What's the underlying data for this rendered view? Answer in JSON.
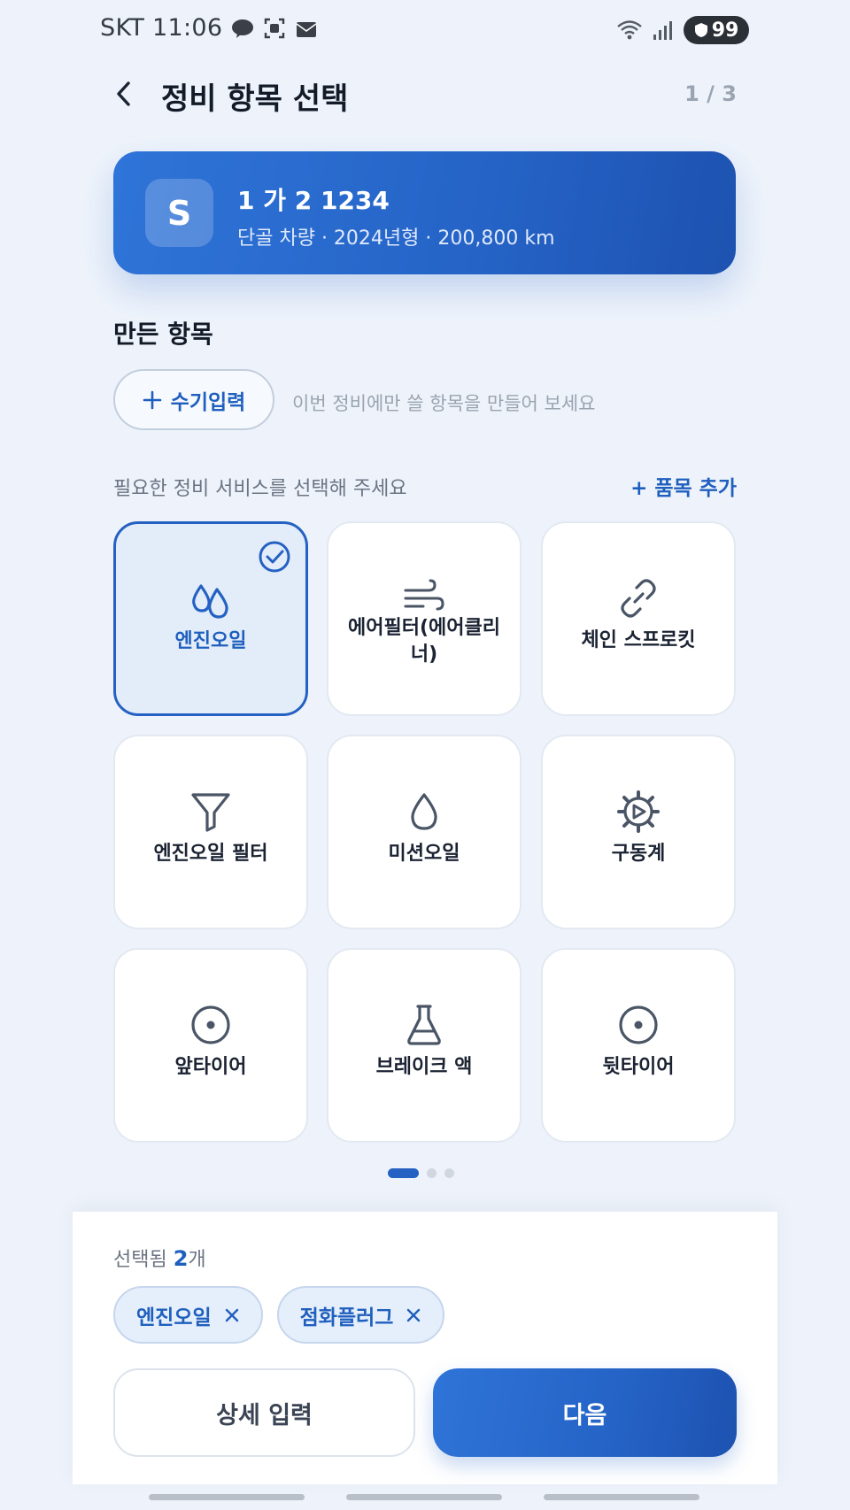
{
  "status_bar": {
    "carrier_time": "SKT 11:06",
    "battery": "99"
  },
  "header": {
    "title": "정비 항목 선택",
    "step": "1 / 3"
  },
  "vehicle": {
    "avatar_letter": "S",
    "plate": "1 가 2 1234",
    "meta": "단골 차량 · 2024년형 · 200,800 km"
  },
  "custom_section": {
    "title": "만든 항목",
    "manual_button": "수기입력",
    "hint": "이번 정비에만 쓸 항목을 만들어 보세요"
  },
  "services": {
    "prompt": "필요한 정비 서비스를 선택해 주세요",
    "add_item": "+ 품목 추가",
    "items": [
      {
        "label": "엔진오일",
        "icon": "oil-drops-icon",
        "selected": true
      },
      {
        "label": "에어필터(에어클리너)",
        "icon": "wind-icon",
        "selected": false
      },
      {
        "label": "체인 스프로킷",
        "icon": "chain-link-icon",
        "selected": false
      },
      {
        "label": "엔진오일 필터",
        "icon": "funnel-filter-icon",
        "selected": false
      },
      {
        "label": "미션오일",
        "icon": "droplet-icon",
        "selected": false
      },
      {
        "label": "구동계",
        "icon": "gear-icon",
        "selected": false
      },
      {
        "label": "앞타이어",
        "icon": "tire-icon",
        "selected": false
      },
      {
        "label": "브레이크 액",
        "icon": "flask-icon",
        "selected": false
      },
      {
        "label": "뒷타이어",
        "icon": "tire-icon",
        "selected": false
      }
    ]
  },
  "pager": {
    "pages": 3,
    "current": 1
  },
  "selection": {
    "prefix": "선택됨 ",
    "count": "2",
    "suffix": "개",
    "chips": [
      "엔진오일",
      "점화플러그"
    ]
  },
  "actions": {
    "detail": "상세 입력",
    "next": "다음"
  },
  "colors": {
    "accent": "#2563c6",
    "selected_bg": "#e3edfa",
    "background": "#eef3fb"
  }
}
